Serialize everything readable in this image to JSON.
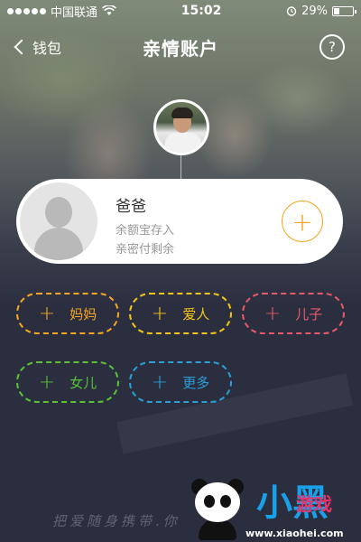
{
  "status_bar": {
    "carrier": "中国联通",
    "time": "15:02",
    "battery_text": "29%",
    "battery_level": 0.29
  },
  "nav": {
    "back_label": "钱包",
    "title": "亲情账户",
    "help_label": "?"
  },
  "card": {
    "name": "爸爸",
    "line1": "余额宝存入",
    "line2": "亲密付剩余",
    "add_label": "+"
  },
  "pills": [
    {
      "label": "妈妈",
      "plus": "+",
      "color": "#f5a623"
    },
    {
      "label": "爱人",
      "plus": "+",
      "color": "#f5c518"
    },
    {
      "label": "儿子",
      "plus": "+",
      "color": "#e85a6a"
    },
    {
      "label": "女儿",
      "plus": "+",
      "color": "#5bc236"
    },
    {
      "label": "更多",
      "plus": "+",
      "color": "#2a9fd8"
    }
  ],
  "watermark": {
    "text": "把爱随身携带.你",
    "brand_big": "小黑",
    "brand_small": "游戏",
    "url": "www.xiaohei.com"
  },
  "colors": {
    "accent": "#f5a623",
    "background": "#2a2e3f"
  }
}
